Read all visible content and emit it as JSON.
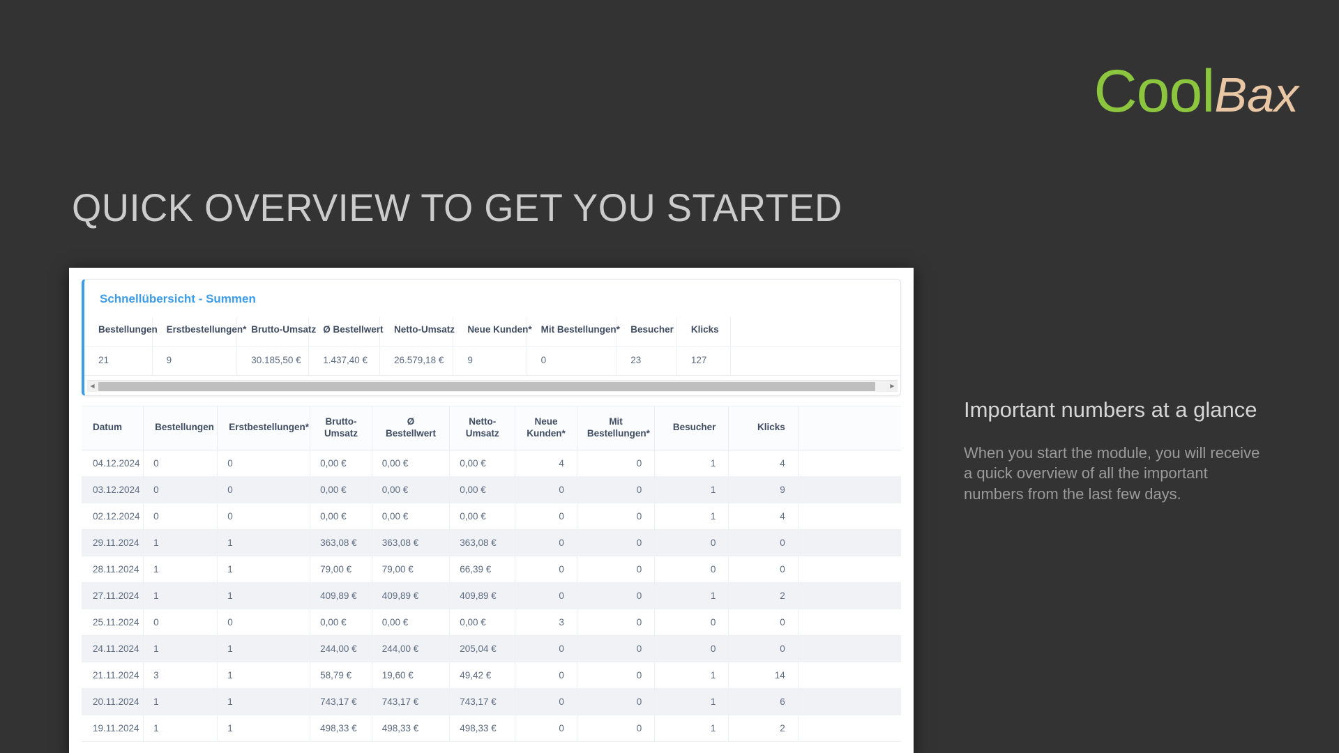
{
  "brand": {
    "name_primary": "Cool",
    "name_secondary": "Bax",
    "color_primary": "#8CC63F",
    "color_secondary": "#E9C6A4"
  },
  "headline": "QUICK OVERVIEW TO GET YOU STARTED",
  "summary_card": {
    "title": "Schnellübersicht - Summen",
    "accent_color": "#3C9CE8",
    "columns": [
      "Bestellungen",
      "Erstbestellungen*",
      "Brutto-Umsatz",
      "Ø Bestellwert",
      "Netto-Umsatz",
      "Neue Kunden*",
      "Mit Bestellungen*",
      "Besucher",
      "Klicks"
    ],
    "values": [
      "21",
      "9",
      "30.185,50 €",
      "1.437,40 €",
      "26.579,18 €",
      "9",
      "0",
      "23",
      "127"
    ],
    "scrollbar": {
      "left_arrow": "◀",
      "right_arrow": "▶"
    }
  },
  "detail_table": {
    "columns": [
      "Datum",
      "Bestellungen",
      "Erstbestellungen*",
      "Brutto-\nUmsatz",
      "Ø\nBestellwert",
      "Netto-\nUmsatz",
      "Neue\nKunden*",
      "Mit\nBestellungen*",
      "Besucher",
      "Klicks",
      ""
    ],
    "columns_display": {
      "c0": "Datum",
      "c1": "Bestellungen",
      "c2": "Erstbestellungen*",
      "c3_l1": "Brutto-",
      "c3_l2": "Umsatz",
      "c4_l1": "Ø",
      "c4_l2": "Bestellwert",
      "c5_l1": "Netto-",
      "c5_l2": "Umsatz",
      "c6_l1": "Neue",
      "c6_l2": "Kunden*",
      "c7_l1": "Mit",
      "c7_l2": "Bestellungen*",
      "c8": "Besucher",
      "c9": "Klicks",
      "c10": ""
    },
    "rows": [
      [
        "04.12.2024",
        "0",
        "0",
        "0,00 €",
        "0,00 €",
        "0,00 €",
        "4",
        "0",
        "1",
        "4",
        ""
      ],
      [
        "03.12.2024",
        "0",
        "0",
        "0,00 €",
        "0,00 €",
        "0,00 €",
        "0",
        "0",
        "1",
        "9",
        ""
      ],
      [
        "02.12.2024",
        "0",
        "0",
        "0,00 €",
        "0,00 €",
        "0,00 €",
        "0",
        "0",
        "1",
        "4",
        ""
      ],
      [
        "29.11.2024",
        "1",
        "1",
        "363,08 €",
        "363,08 €",
        "363,08 €",
        "0",
        "0",
        "0",
        "0",
        ""
      ],
      [
        "28.11.2024",
        "1",
        "1",
        "79,00 €",
        "79,00 €",
        "66,39 €",
        "0",
        "0",
        "0",
        "0",
        ""
      ],
      [
        "27.11.2024",
        "1",
        "1",
        "409,89 €",
        "409,89 €",
        "409,89 €",
        "0",
        "0",
        "1",
        "2",
        ""
      ],
      [
        "25.11.2024",
        "0",
        "0",
        "0,00 €",
        "0,00 €",
        "0,00 €",
        "3",
        "0",
        "0",
        "0",
        ""
      ],
      [
        "24.11.2024",
        "1",
        "1",
        "244,00 €",
        "244,00 €",
        "205,04 €",
        "0",
        "0",
        "0",
        "0",
        ""
      ],
      [
        "21.11.2024",
        "3",
        "1",
        "58,79 €",
        "19,60 €",
        "49,42 €",
        "0",
        "0",
        "1",
        "14",
        ""
      ],
      [
        "20.11.2024",
        "1",
        "1",
        "743,17 €",
        "743,17 €",
        "743,17 €",
        "0",
        "0",
        "1",
        "6",
        ""
      ],
      [
        "19.11.2024",
        "1",
        "1",
        "498,33 €",
        "498,33 €",
        "498,33 €",
        "0",
        "0",
        "1",
        "2",
        ""
      ]
    ]
  },
  "sidebar": {
    "heading": "Important numbers at a glance",
    "body": "When you start the module, you will receive a quick overview of all the important numbers from the last few days."
  }
}
